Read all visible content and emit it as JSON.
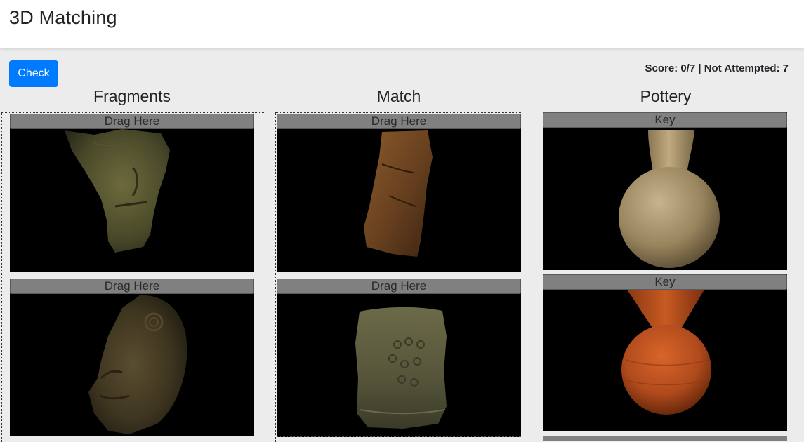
{
  "header": {
    "title": "3D Matching"
  },
  "toolbar": {
    "check_label": "Check",
    "score_text": "Score: 0/7 | Not Attempted: 7"
  },
  "columns": {
    "fragments": {
      "heading": "Fragments",
      "cards": [
        {
          "bar_label": "Drag Here",
          "model": "fragment-face-green"
        },
        {
          "bar_label": "Drag Here",
          "model": "fragment-face-brown"
        }
      ]
    },
    "match": {
      "heading": "Match",
      "cards": [
        {
          "bar_label": "Drag Here",
          "model": "fragment-orange-shard"
        },
        {
          "bar_label": "Drag Here",
          "model": "fragment-stamped-block"
        }
      ]
    },
    "pottery": {
      "heading": "Pottery",
      "cards": [
        {
          "bar_label": "Key",
          "model": "vase-tan-globe"
        },
        {
          "bar_label": "Key",
          "model": "vase-orange-gourd"
        }
      ]
    }
  }
}
